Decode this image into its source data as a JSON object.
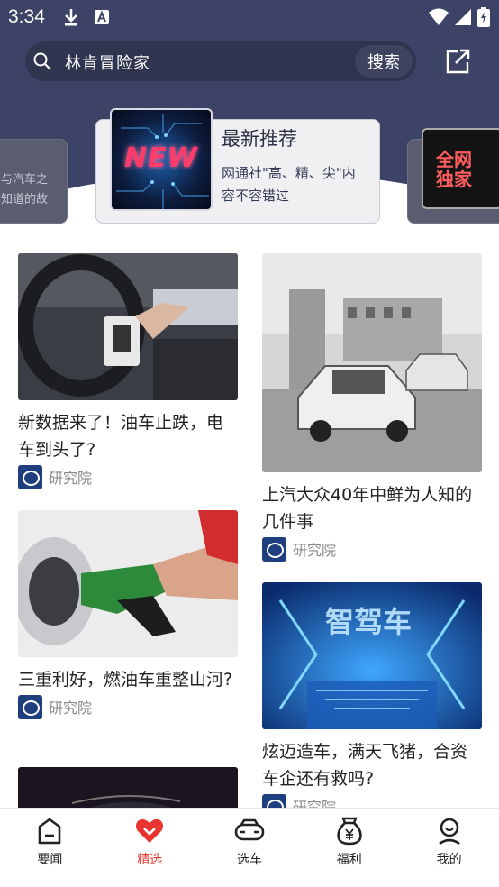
{
  "status_bar": {
    "time": "3:34"
  },
  "search": {
    "query": "林肯冒险家",
    "button_label": "搜索"
  },
  "carousel": {
    "left_card_text": "与汽车之知道的故",
    "main_card": {
      "badge": "NEW",
      "title": "最新推荐",
      "description": "网通社\"高、精、尖\"内容不容错过"
    },
    "right_card": {
      "badge": "全网独家"
    }
  },
  "feed": {
    "items": [
      {
        "title": "新数据来了！油车止跌，电车到头了?",
        "source": "研究院"
      },
      {
        "title": "上汽大众40年中鲜为人知的几件事",
        "source": "研究院"
      },
      {
        "title": "三重利好，燃油车重整山河?",
        "source": "研究院"
      },
      {
        "title": "炫迈造车，满天飞猪，合资车企还有救吗?",
        "source": "研究院"
      }
    ]
  },
  "bottom_nav": {
    "items": [
      {
        "label": "要闻",
        "icon": "home-icon"
      },
      {
        "label": "精选",
        "icon": "heart-icon",
        "active": true
      },
      {
        "label": "选车",
        "icon": "car-icon"
      },
      {
        "label": "福利",
        "icon": "money-bag-icon"
      },
      {
        "label": "我的",
        "icon": "user-icon"
      }
    ]
  },
  "colors": {
    "header_bg": "#3d4366",
    "active_red": "#e8352f"
  }
}
